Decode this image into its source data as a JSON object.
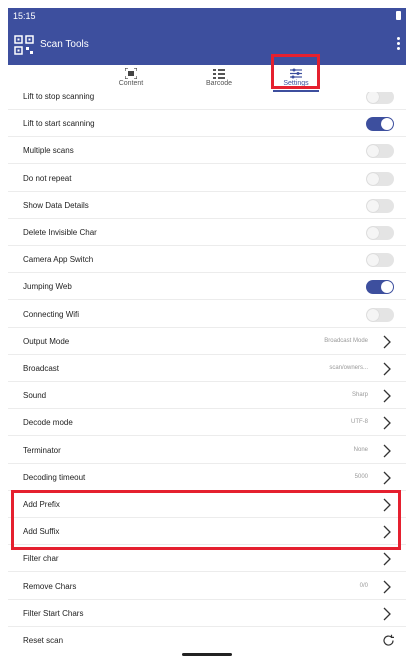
{
  "status_bar": {
    "time": "15:15"
  },
  "app": {
    "title": "Scan Tools"
  },
  "tabs": [
    {
      "label": "Content",
      "icon": "scan-icon"
    },
    {
      "label": "Barcode",
      "icon": "barcode-list-icon"
    },
    {
      "label": "Settings",
      "icon": "sliders-icon"
    }
  ],
  "colors": {
    "accent": "#3d4f9e",
    "highlight": "#e5202f"
  },
  "settings": [
    {
      "label": "Lift to stop scanning",
      "type": "toggle",
      "on": false
    },
    {
      "label": "Lift to start scanning",
      "type": "toggle",
      "on": true
    },
    {
      "label": "Multiple scans",
      "type": "toggle",
      "on": false
    },
    {
      "label": "Do not repeat",
      "type": "toggle",
      "on": false
    },
    {
      "label": "Show Data Details",
      "type": "toggle",
      "on": false
    },
    {
      "label": "Delete Invisible Char",
      "type": "toggle",
      "on": false
    },
    {
      "label": "Camera App Switch",
      "type": "toggle",
      "on": false
    },
    {
      "label": "Jumping Web",
      "type": "toggle",
      "on": true
    },
    {
      "label": "Connecting Wifi",
      "type": "toggle",
      "on": false
    },
    {
      "label": "Output Mode",
      "type": "nav",
      "value": "Broadcast Mode"
    },
    {
      "label": "Broadcast",
      "type": "nav",
      "value": "scan/owners..."
    },
    {
      "label": "Sound",
      "type": "nav",
      "value": "Sharp"
    },
    {
      "label": "Decode mode",
      "type": "nav",
      "value": "UTF-8"
    },
    {
      "label": "Terminator",
      "type": "nav",
      "value": "None"
    },
    {
      "label": "Decoding timeout",
      "type": "nav",
      "value": "5000"
    },
    {
      "label": "Add Prefix",
      "type": "nav",
      "value": ""
    },
    {
      "label": "Add Suffix",
      "type": "nav",
      "value": ""
    },
    {
      "label": "Filter char",
      "type": "nav",
      "value": ""
    },
    {
      "label": "Remove Chars",
      "type": "nav",
      "value": "0/0"
    },
    {
      "label": "Filter Start Chars",
      "type": "nav",
      "value": ""
    },
    {
      "label": "Reset scan",
      "type": "action",
      "value": ""
    }
  ]
}
